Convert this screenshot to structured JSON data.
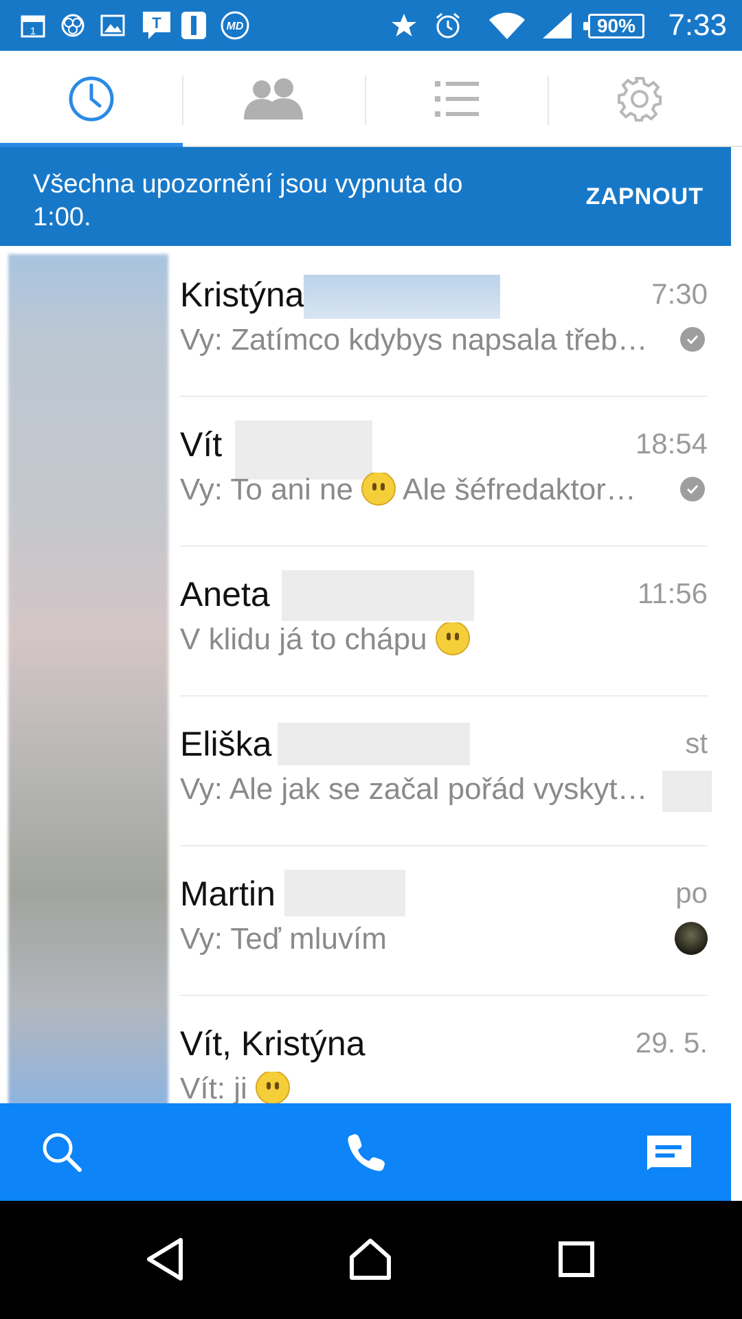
{
  "status_bar": {
    "battery": "90%",
    "time": "7:33"
  },
  "tabs": [
    {
      "icon": "clock-icon",
      "active": true
    },
    {
      "icon": "people-icon",
      "active": false
    },
    {
      "icon": "list-icon",
      "active": false
    },
    {
      "icon": "gear-icon",
      "active": false
    }
  ],
  "banner": {
    "text": "Všechna upozornění jsou vypnuta do 1:00.",
    "button": "ZAPNOUT"
  },
  "conversations": [
    {
      "name": "Kristýna",
      "time": "7:30",
      "message": "Vy: Zatímco kdybys napsala třeb…",
      "status": "sent-check"
    },
    {
      "name": "Vít",
      "time": "18:54",
      "message_before": "Vy: To ani ne ",
      "message_after": " Ale šéfredaktor…",
      "status": "sent-check"
    },
    {
      "name": "Aneta",
      "time": "11:56",
      "message": "V klidu já to chápu",
      "status": "none"
    },
    {
      "name": "Eliška",
      "time": "st",
      "message": "Vy: Ale jak se začal pořád vyskyt…",
      "status": "hidden"
    },
    {
      "name": "Martin",
      "time": "po",
      "message": "Vy: Teď mluvím",
      "status": "seen-avatar"
    },
    {
      "name": "Vít, Kristýna",
      "time": "29. 5.",
      "message": "Vít: ji",
      "status": "none"
    }
  ],
  "action_bar": {
    "icons": [
      "search-icon",
      "phone-icon",
      "new-message-icon"
    ]
  },
  "colors": {
    "status_bar": "#1878c8",
    "accent": "#2a8ae6",
    "action_bar": "#0d84f7"
  }
}
